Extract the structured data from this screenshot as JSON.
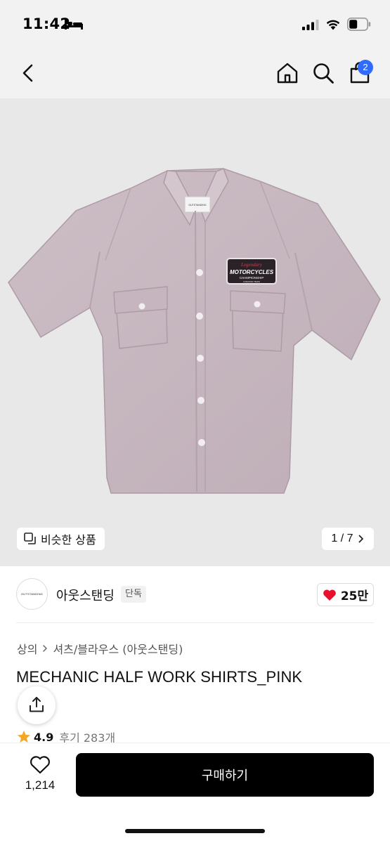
{
  "status_bar": {
    "time": "11:42",
    "icons": [
      "bed-icon",
      "signal-icon",
      "wifi-icon",
      "battery-icon"
    ]
  },
  "nav": {
    "icons": [
      "back-icon",
      "home-icon",
      "search-icon",
      "cart-icon"
    ],
    "cart_badge": "2"
  },
  "gallery": {
    "similar_label": "비슷한 상품",
    "page_indicator": "1 / 7",
    "shirt_patch": {
      "line1": "Legendary",
      "line2": "MOTORCYCLES",
      "line3": "CHAMPIONSHIP",
      "line4": "& RACING TEAM"
    },
    "neck_label": "OUTSTANDING"
  },
  "brand": {
    "logo_text": "OUTSTANDING",
    "name": "아웃스탠딩",
    "tag": "단독",
    "likes": "25만"
  },
  "product": {
    "breadcrumb": [
      "상의",
      "셔츠/블라우스 (아웃스탠딩)"
    ],
    "title": "MECHANIC HALF WORK SHIRTS_PINK",
    "rating": "4.9",
    "reviews": "후기 283개"
  },
  "bottom_bar": {
    "wish_count": "1,214",
    "buy_label": "구매하기"
  },
  "colors": {
    "accent_blue": "#2f6bff",
    "buy_button": "#000000",
    "heart": "#e8112d",
    "star": "#f5a623",
    "shirt": "#c9b8c0"
  }
}
